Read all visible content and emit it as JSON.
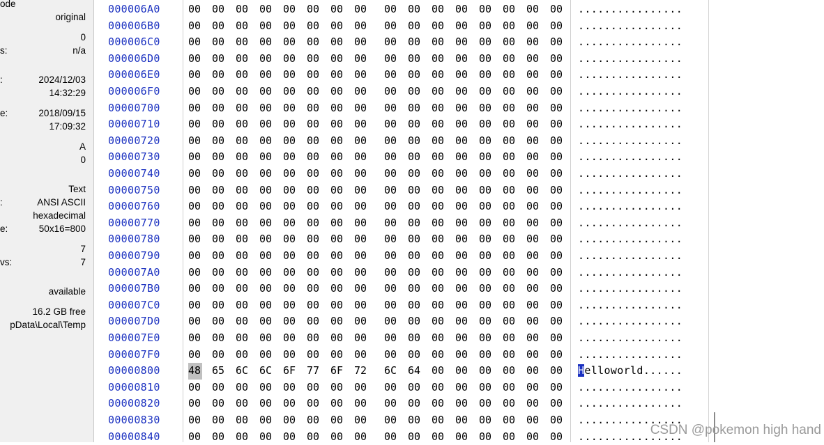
{
  "info_pane": {
    "items": [
      {
        "label": "ode",
        "value": ""
      },
      {
        "label": "",
        "value": "original"
      },
      {
        "label": "",
        "value": "0"
      },
      {
        "label": "s:",
        "value": "n/a"
      },
      {
        "label": ":",
        "value": "2024/12/03"
      },
      {
        "label": "",
        "value": "14:32:29"
      },
      {
        "label": "e:",
        "value": "2018/09/15"
      },
      {
        "label": "",
        "value": "17:09:32"
      },
      {
        "label": "",
        "value": "A"
      },
      {
        "label": "",
        "value": "0"
      },
      {
        "label": "",
        "value": "Text"
      },
      {
        "label": ":",
        "value": "ANSI ASCII"
      },
      {
        "label": "",
        "value": "hexadecimal"
      },
      {
        "label": "e:",
        "value": "50x16=800"
      },
      {
        "label": "",
        "value": "7"
      },
      {
        "label": "vs:",
        "value": "7"
      },
      {
        "label": "",
        "value": "available"
      },
      {
        "label": "",
        "value": "16.2 GB free"
      },
      {
        "label": "",
        "value": "pData\\Local\\Temp"
      }
    ]
  },
  "hex": {
    "rows": [
      {
        "offset": "000006A0",
        "bytes": [
          "00",
          "00",
          "00",
          "00",
          "00",
          "00",
          "00",
          "00",
          "00",
          "00",
          "00",
          "00",
          "00",
          "00",
          "00",
          "00"
        ],
        "ascii": "................"
      },
      {
        "offset": "000006B0",
        "bytes": [
          "00",
          "00",
          "00",
          "00",
          "00",
          "00",
          "00",
          "00",
          "00",
          "00",
          "00",
          "00",
          "00",
          "00",
          "00",
          "00"
        ],
        "ascii": "................"
      },
      {
        "offset": "000006C0",
        "bytes": [
          "00",
          "00",
          "00",
          "00",
          "00",
          "00",
          "00",
          "00",
          "00",
          "00",
          "00",
          "00",
          "00",
          "00",
          "00",
          "00"
        ],
        "ascii": "................"
      },
      {
        "offset": "000006D0",
        "bytes": [
          "00",
          "00",
          "00",
          "00",
          "00",
          "00",
          "00",
          "00",
          "00",
          "00",
          "00",
          "00",
          "00",
          "00",
          "00",
          "00"
        ],
        "ascii": "................"
      },
      {
        "offset": "000006E0",
        "bytes": [
          "00",
          "00",
          "00",
          "00",
          "00",
          "00",
          "00",
          "00",
          "00",
          "00",
          "00",
          "00",
          "00",
          "00",
          "00",
          "00"
        ],
        "ascii": "................"
      },
      {
        "offset": "000006F0",
        "bytes": [
          "00",
          "00",
          "00",
          "00",
          "00",
          "00",
          "00",
          "00",
          "00",
          "00",
          "00",
          "00",
          "00",
          "00",
          "00",
          "00"
        ],
        "ascii": "................"
      },
      {
        "offset": "00000700",
        "bytes": [
          "00",
          "00",
          "00",
          "00",
          "00",
          "00",
          "00",
          "00",
          "00",
          "00",
          "00",
          "00",
          "00",
          "00",
          "00",
          "00"
        ],
        "ascii": "................"
      },
      {
        "offset": "00000710",
        "bytes": [
          "00",
          "00",
          "00",
          "00",
          "00",
          "00",
          "00",
          "00",
          "00",
          "00",
          "00",
          "00",
          "00",
          "00",
          "00",
          "00"
        ],
        "ascii": "................"
      },
      {
        "offset": "00000720",
        "bytes": [
          "00",
          "00",
          "00",
          "00",
          "00",
          "00",
          "00",
          "00",
          "00",
          "00",
          "00",
          "00",
          "00",
          "00",
          "00",
          "00"
        ],
        "ascii": "................"
      },
      {
        "offset": "00000730",
        "bytes": [
          "00",
          "00",
          "00",
          "00",
          "00",
          "00",
          "00",
          "00",
          "00",
          "00",
          "00",
          "00",
          "00",
          "00",
          "00",
          "00"
        ],
        "ascii": "................"
      },
      {
        "offset": "00000740",
        "bytes": [
          "00",
          "00",
          "00",
          "00",
          "00",
          "00",
          "00",
          "00",
          "00",
          "00",
          "00",
          "00",
          "00",
          "00",
          "00",
          "00"
        ],
        "ascii": "................"
      },
      {
        "offset": "00000750",
        "bytes": [
          "00",
          "00",
          "00",
          "00",
          "00",
          "00",
          "00",
          "00",
          "00",
          "00",
          "00",
          "00",
          "00",
          "00",
          "00",
          "00"
        ],
        "ascii": "................"
      },
      {
        "offset": "00000760",
        "bytes": [
          "00",
          "00",
          "00",
          "00",
          "00",
          "00",
          "00",
          "00",
          "00",
          "00",
          "00",
          "00",
          "00",
          "00",
          "00",
          "00"
        ],
        "ascii": "................"
      },
      {
        "offset": "00000770",
        "bytes": [
          "00",
          "00",
          "00",
          "00",
          "00",
          "00",
          "00",
          "00",
          "00",
          "00",
          "00",
          "00",
          "00",
          "00",
          "00",
          "00"
        ],
        "ascii": "................"
      },
      {
        "offset": "00000780",
        "bytes": [
          "00",
          "00",
          "00",
          "00",
          "00",
          "00",
          "00",
          "00",
          "00",
          "00",
          "00",
          "00",
          "00",
          "00",
          "00",
          "00"
        ],
        "ascii": "................"
      },
      {
        "offset": "00000790",
        "bytes": [
          "00",
          "00",
          "00",
          "00",
          "00",
          "00",
          "00",
          "00",
          "00",
          "00",
          "00",
          "00",
          "00",
          "00",
          "00",
          "00"
        ],
        "ascii": "................"
      },
      {
        "offset": "000007A0",
        "bytes": [
          "00",
          "00",
          "00",
          "00",
          "00",
          "00",
          "00",
          "00",
          "00",
          "00",
          "00",
          "00",
          "00",
          "00",
          "00",
          "00"
        ],
        "ascii": "................"
      },
      {
        "offset": "000007B0",
        "bytes": [
          "00",
          "00",
          "00",
          "00",
          "00",
          "00",
          "00",
          "00",
          "00",
          "00",
          "00",
          "00",
          "00",
          "00",
          "00",
          "00"
        ],
        "ascii": "................"
      },
      {
        "offset": "000007C0",
        "bytes": [
          "00",
          "00",
          "00",
          "00",
          "00",
          "00",
          "00",
          "00",
          "00",
          "00",
          "00",
          "00",
          "00",
          "00",
          "00",
          "00"
        ],
        "ascii": "................"
      },
      {
        "offset": "000007D0",
        "bytes": [
          "00",
          "00",
          "00",
          "00",
          "00",
          "00",
          "00",
          "00",
          "00",
          "00",
          "00",
          "00",
          "00",
          "00",
          "00",
          "00"
        ],
        "ascii": "................"
      },
      {
        "offset": "000007E0",
        "bytes": [
          "00",
          "00",
          "00",
          "00",
          "00",
          "00",
          "00",
          "00",
          "00",
          "00",
          "00",
          "00",
          "00",
          "00",
          "00",
          "00"
        ],
        "ascii": "................"
      },
      {
        "offset": "000007F0",
        "bytes": [
          "00",
          "00",
          "00",
          "00",
          "00",
          "00",
          "00",
          "00",
          "00",
          "00",
          "00",
          "00",
          "00",
          "00",
          "00",
          "00"
        ],
        "ascii": "................"
      },
      {
        "offset": "00000800",
        "bytes": [
          "48",
          "65",
          "6C",
          "6C",
          "6F",
          "77",
          "6F",
          "72",
          "6C",
          "64",
          "00",
          "00",
          "00",
          "00",
          "00",
          "00"
        ],
        "ascii": "Helloworld......",
        "selected_byte": 0,
        "caret_char": 0
      },
      {
        "offset": "00000810",
        "bytes": [
          "00",
          "00",
          "00",
          "00",
          "00",
          "00",
          "00",
          "00",
          "00",
          "00",
          "00",
          "00",
          "00",
          "00",
          "00",
          "00"
        ],
        "ascii": "................"
      },
      {
        "offset": "00000820",
        "bytes": [
          "00",
          "00",
          "00",
          "00",
          "00",
          "00",
          "00",
          "00",
          "00",
          "00",
          "00",
          "00",
          "00",
          "00",
          "00",
          "00"
        ],
        "ascii": "................"
      },
      {
        "offset": "00000830",
        "bytes": [
          "00",
          "00",
          "00",
          "00",
          "00",
          "00",
          "00",
          "00",
          "00",
          "00",
          "00",
          "00",
          "00",
          "00",
          "00",
          "00"
        ],
        "ascii": "................"
      },
      {
        "offset": "00000840",
        "bytes": [
          "00",
          "00",
          "00",
          "00",
          "00",
          "00",
          "00",
          "00",
          "00",
          "00",
          "00",
          "00",
          "00",
          "00",
          "00",
          "00"
        ],
        "ascii": "................"
      }
    ]
  },
  "watermark": "CSDN @pokemon high hand",
  "colors": {
    "offset": "#1a30c0",
    "caret": "#1a30c0",
    "selection": "#c0c0c0"
  }
}
